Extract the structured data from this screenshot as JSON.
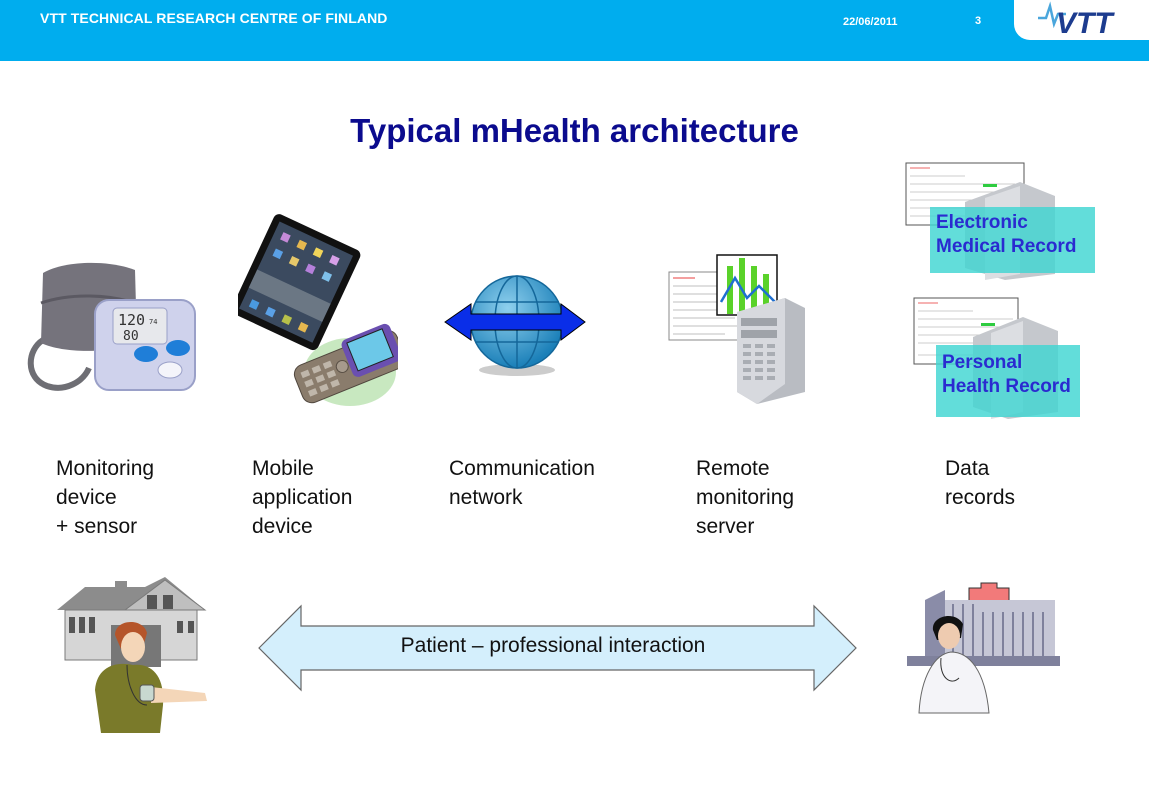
{
  "header": {
    "organization": "VTT TECHNICAL RESEARCH CENTRE OF FINLAND",
    "date": "22/06/2011",
    "page_number": "3",
    "logo_text": "VTT",
    "background_color": "#00adee"
  },
  "slide": {
    "title": "Typical mHealth architecture",
    "title_color": "#0b0b8e"
  },
  "components": [
    {
      "id": "monitoring",
      "icon": "blood-pressure-monitor-icon",
      "lines": [
        "Monitoring",
        "device",
        "+ sensor"
      ]
    },
    {
      "id": "mobile",
      "icon": "tablet-and-phone-icon",
      "lines": [
        "Mobile",
        "application",
        "device"
      ]
    },
    {
      "id": "network",
      "icon": "globe-with-arrows-icon",
      "lines": [
        "Communication",
        "network"
      ]
    },
    {
      "id": "server",
      "icon": "server-with-chart-icon",
      "lines": [
        "Remote",
        "monitoring",
        "server"
      ]
    },
    {
      "id": "records",
      "icon": "record-servers-icon",
      "lines": [
        "Data",
        "records"
      ]
    }
  ],
  "records": {
    "emr": [
      "Electronic",
      "Medical Record"
    ],
    "phr": [
      "Personal",
      "Health Record"
    ],
    "box_color": "#40d6d2",
    "text_color": "#2a2bd0"
  },
  "monitor_display": {
    "systolic": "120",
    "diastolic": "80",
    "pulse": "74"
  },
  "interaction": {
    "label": "Patient – professional interaction",
    "left_actor": "patient-at-home-icon",
    "right_actor": "doctor-at-hospital-icon",
    "arrow_color": "#d4effc"
  }
}
